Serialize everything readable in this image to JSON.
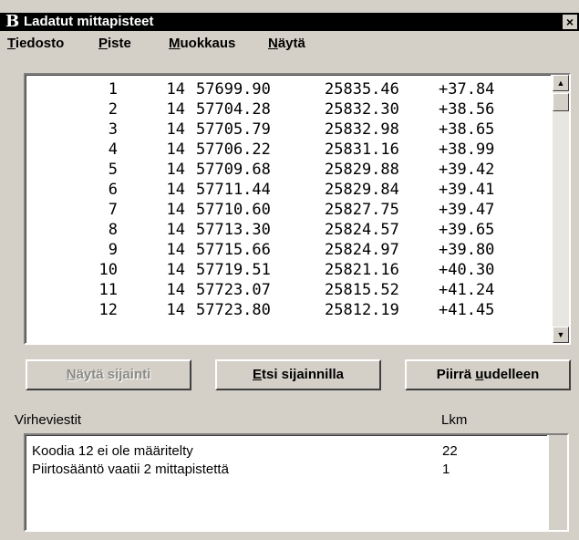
{
  "window": {
    "logo": "B",
    "title": "Ladatut mittapisteet",
    "close_glyph": "×"
  },
  "menu": [
    {
      "accel": "T",
      "rest": "iedosto"
    },
    {
      "accel": "P",
      "rest": "iste"
    },
    {
      "accel": "M",
      "rest": "uokkaus"
    },
    {
      "accel": "N",
      "rest": "äytä"
    }
  ],
  "points": [
    {
      "no": "1",
      "code": "14",
      "x": "57699.90",
      "y": "25835.46",
      "z": "+37.84"
    },
    {
      "no": "2",
      "code": "14",
      "x": "57704.28",
      "y": "25832.30",
      "z": "+38.56"
    },
    {
      "no": "3",
      "code": "14",
      "x": "57705.79",
      "y": "25832.98",
      "z": "+38.65"
    },
    {
      "no": "4",
      "code": "14",
      "x": "57706.22",
      "y": "25831.16",
      "z": "+38.99"
    },
    {
      "no": "5",
      "code": "14",
      "x": "57709.68",
      "y": "25829.88",
      "z": "+39.42"
    },
    {
      "no": "6",
      "code": "14",
      "x": "57711.44",
      "y": "25829.84",
      "z": "+39.41"
    },
    {
      "no": "7",
      "code": "14",
      "x": "57710.60",
      "y": "25827.75",
      "z": "+39.47"
    },
    {
      "no": "8",
      "code": "14",
      "x": "57713.30",
      "y": "25824.57",
      "z": "+39.65"
    },
    {
      "no": "9",
      "code": "14",
      "x": "57715.66",
      "y": "25824.97",
      "z": "+39.80"
    },
    {
      "no": "10",
      "code": "14",
      "x": "57719.51",
      "y": "25821.16",
      "z": "+40.30"
    },
    {
      "no": "11",
      "code": "14",
      "x": "57723.07",
      "y": "25815.52",
      "z": "+41.24"
    },
    {
      "no": "12",
      "code": "14",
      "x": "57723.80",
      "y": "25812.19",
      "z": "+41.45"
    }
  ],
  "scroll": {
    "up_icon": "▲",
    "down_icon": "▼"
  },
  "buttons": {
    "show_location": {
      "accel": "N",
      "rest": "äytä sijainti"
    },
    "search_by_location": {
      "accel": "E",
      "rest": "tsi sijainnilla"
    },
    "redraw": {
      "pre": "Piirrä ",
      "accel": "u",
      "rest": "udelleen"
    }
  },
  "errors": {
    "header_messages": "Virheviestit",
    "header_count": "Lkm",
    "rows": [
      {
        "message": "Koodia 12 ei ole määritelty",
        "count": "22"
      },
      {
        "message": "Piirtosääntö vaatii 2 mittapistettä",
        "count": "1"
      }
    ]
  }
}
